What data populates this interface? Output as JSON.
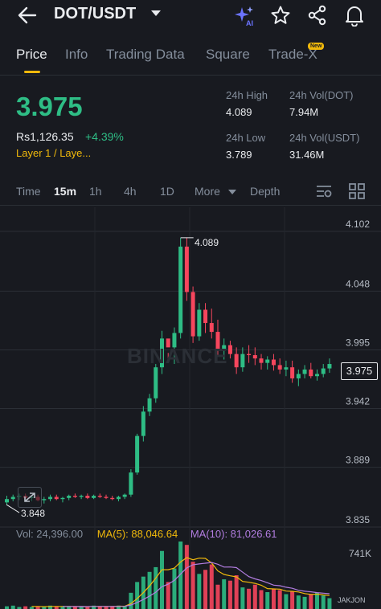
{
  "header": {
    "pair": "DOT/USDT",
    "icons": [
      "back-arrow-icon",
      "ai-sparkle-icon",
      "star-icon",
      "share-icon",
      "bell-icon"
    ],
    "ai_badge": "AI"
  },
  "tabs": [
    {
      "label": "Price",
      "active": true
    },
    {
      "label": "Info"
    },
    {
      "label": "Trading Data"
    },
    {
      "label": "Square"
    },
    {
      "label": "Trade-X",
      "badge": "New"
    }
  ],
  "ticker": {
    "last_price": "3.975",
    "fiat_value": "Rs1,126.35",
    "change_pct": "+4.39%",
    "sector": "Layer 1 / Laye...",
    "high_label": "24h High",
    "high_value": "4.089",
    "low_label": "24h Low",
    "low_value": "3.789",
    "vol_base_label": "24h Vol(DOT)",
    "vol_base_value": "7.94M",
    "vol_quote_label": "24h Vol(USDT)",
    "vol_quote_value": "31.46M"
  },
  "intervals": {
    "items": [
      "Time",
      "15m",
      "1h",
      "4h",
      "1D",
      "More",
      "Depth"
    ],
    "active": "15m"
  },
  "chart_data": {
    "type": "candlestick",
    "y_ticks": [
      "4.102",
      "4.048",
      "3.995",
      "3.942",
      "3.889",
      "3.835"
    ],
    "ylim": [
      3.835,
      4.102
    ],
    "high_marker": "4.089",
    "low_marker": "3.848",
    "last_price": "3.975",
    "watermark": "BINANCE",
    "candles": [
      [
        3.85,
        3.856,
        3.848,
        3.853
      ],
      [
        3.853,
        3.857,
        3.851,
        3.855
      ],
      [
        3.855,
        3.858,
        3.852,
        3.856
      ],
      [
        3.856,
        3.858,
        3.853,
        3.854
      ],
      [
        3.854,
        3.856,
        3.851,
        3.855
      ],
      [
        3.855,
        3.857,
        3.851,
        3.852
      ],
      [
        3.852,
        3.855,
        3.849,
        3.853
      ],
      [
        3.853,
        3.857,
        3.851,
        3.855
      ],
      [
        3.855,
        3.857,
        3.852,
        3.853
      ],
      [
        3.853,
        3.855,
        3.85,
        3.854
      ],
      [
        3.854,
        3.857,
        3.852,
        3.856
      ],
      [
        3.856,
        3.858,
        3.854,
        3.855
      ],
      [
        3.855,
        3.857,
        3.853,
        3.856
      ],
      [
        3.856,
        3.858,
        3.853,
        3.854
      ],
      [
        3.854,
        3.857,
        3.853,
        3.856
      ],
      [
        3.856,
        3.858,
        3.854,
        3.855
      ],
      [
        3.855,
        3.857,
        3.853,
        3.854
      ],
      [
        3.854,
        3.856,
        3.852,
        3.853
      ],
      [
        3.853,
        3.856,
        3.851,
        3.855
      ],
      [
        3.855,
        3.858,
        3.853,
        3.857
      ],
      [
        3.857,
        3.88,
        3.855,
        3.877
      ],
      [
        3.877,
        3.912,
        3.875,
        3.91
      ],
      [
        3.91,
        3.937,
        3.905,
        3.932
      ],
      [
        3.932,
        3.948,
        3.928,
        3.944
      ],
      [
        3.944,
        3.975,
        3.94,
        3.972
      ],
      [
        3.972,
        4.005,
        3.966,
        3.998
      ],
      [
        3.998,
        3.985,
        3.978,
        3.99
      ],
      [
        3.99,
        4.008,
        3.975,
        4.003
      ],
      [
        4.003,
        4.089,
        3.998,
        4.081
      ],
      [
        4.081,
        4.089,
        4.032,
        4.04
      ],
      [
        4.04,
        4.045,
        3.994,
        4.0
      ],
      [
        4.0,
        4.03,
        3.996,
        4.024
      ],
      [
        4.024,
        4.03,
        4.003,
        4.012
      ],
      [
        4.012,
        4.025,
        3.998,
        4.004
      ],
      [
        4.004,
        4.015,
        3.982,
        3.988
      ],
      [
        3.988,
        3.998,
        3.979,
        3.992
      ],
      [
        3.992,
        3.996,
        3.98,
        3.984
      ],
      [
        3.984,
        3.99,
        3.966,
        3.972
      ],
      [
        3.972,
        3.99,
        3.968,
        3.984
      ],
      [
        3.984,
        3.992,
        3.976,
        3.983
      ],
      [
        3.983,
        3.99,
        3.974,
        3.98
      ],
      [
        3.98,
        3.984,
        3.97,
        3.976
      ],
      [
        3.976,
        3.982,
        3.97,
        3.979
      ],
      [
        3.979,
        3.984,
        3.969,
        3.974
      ],
      [
        3.974,
        3.98,
        3.966,
        3.97
      ],
      [
        3.97,
        3.978,
        3.964,
        3.972
      ],
      [
        3.972,
        3.978,
        3.958,
        3.962
      ],
      [
        3.962,
        3.97,
        3.955,
        3.966
      ],
      [
        3.966,
        3.974,
        3.962,
        3.97
      ],
      [
        3.97,
        3.976,
        3.962,
        3.964
      ],
      [
        3.964,
        3.97,
        3.96,
        3.966
      ],
      [
        3.966,
        3.975,
        3.963,
        3.971
      ],
      [
        3.971,
        3.98,
        3.967,
        3.975
      ]
    ]
  },
  "volume": {
    "vol_label": "Vol: 24,396.00",
    "ma5_label": "MA(5): 88,046.64",
    "ma10_label": "MA(10): 81,026.61",
    "axis_max": "741K",
    "ma5_color": "#f0b90b",
    "ma10_color": "#b27de0",
    "bars": [
      4,
      5,
      3,
      4,
      3,
      4,
      3,
      5,
      4,
      3,
      4,
      3,
      4,
      3,
      5,
      4,
      3,
      4,
      5,
      4,
      24,
      40,
      48,
      55,
      62,
      86,
      40,
      60,
      100,
      95,
      70,
      52,
      58,
      66,
      36,
      44,
      42,
      50,
      32,
      30,
      36,
      28,
      25,
      30,
      28,
      22,
      26,
      20,
      18,
      22,
      24,
      20,
      16
    ],
    "attribution": "JAKJON"
  },
  "colors": {
    "up": "#2ebd85",
    "down": "#f6465d",
    "accent": "#f0b90b",
    "bg": "#181a20"
  }
}
